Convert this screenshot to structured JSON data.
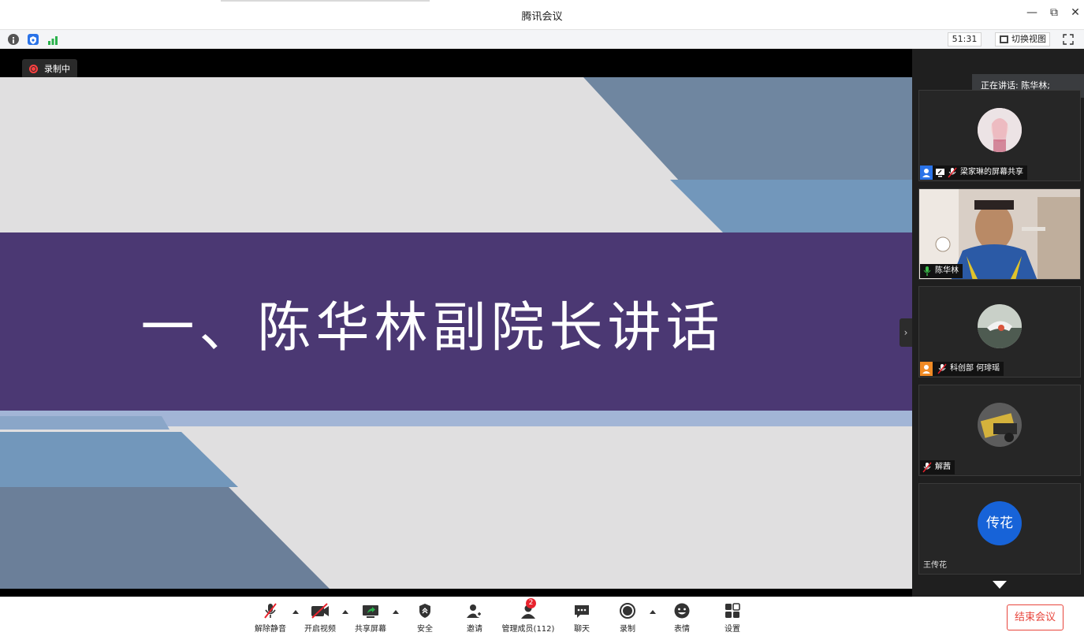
{
  "window": {
    "title": "腾讯会议",
    "controls": {
      "minimize": "—",
      "restore": "⧉",
      "close": "✕"
    }
  },
  "infobar": {
    "icons": [
      "info-icon",
      "shield-icon",
      "signal-icon"
    ],
    "timer": "51:31",
    "switch_view_label": "切换视图"
  },
  "stage": {
    "recording_label": "录制中",
    "slide_title": "一、陈华林副院长讲话",
    "colors": {
      "purple_band": "#4b3873",
      "blue_shape": "#7297bb",
      "gray_shape": "#6b7f99",
      "background": "#e0dfe0"
    }
  },
  "side_panel": {
    "speaking_label": "正在讲话: 陈华林;",
    "participants": [
      {
        "name": "梁家琳的屏幕共享",
        "avatar": "photo",
        "icons": [
          "user-icon",
          "screen-share-icon",
          "mic-muted-icon"
        ]
      },
      {
        "name": "陈华林",
        "avatar": "video",
        "icons": [
          "mic-active-icon"
        ]
      },
      {
        "name": "科创部 何琲瑶",
        "avatar": "photo",
        "icons": [
          "user-icon",
          "mic-muted-icon"
        ]
      },
      {
        "name": "解茜",
        "avatar": "photo",
        "icons": [
          "mic-muted-icon"
        ]
      },
      {
        "name": "王传花",
        "avatar": "text",
        "avatar_text": "传花",
        "icons": []
      }
    ]
  },
  "toolbar": {
    "unmute": "解除静音",
    "start_video": "开启视频",
    "share_screen": "共享屏幕",
    "security": "安全",
    "invite": "邀请",
    "manage_members": "管理成员(112)",
    "manage_badge": "2",
    "chat": "聊天",
    "record": "录制",
    "emoji": "表情",
    "settings": "设置",
    "end_meeting": "结束会议"
  }
}
